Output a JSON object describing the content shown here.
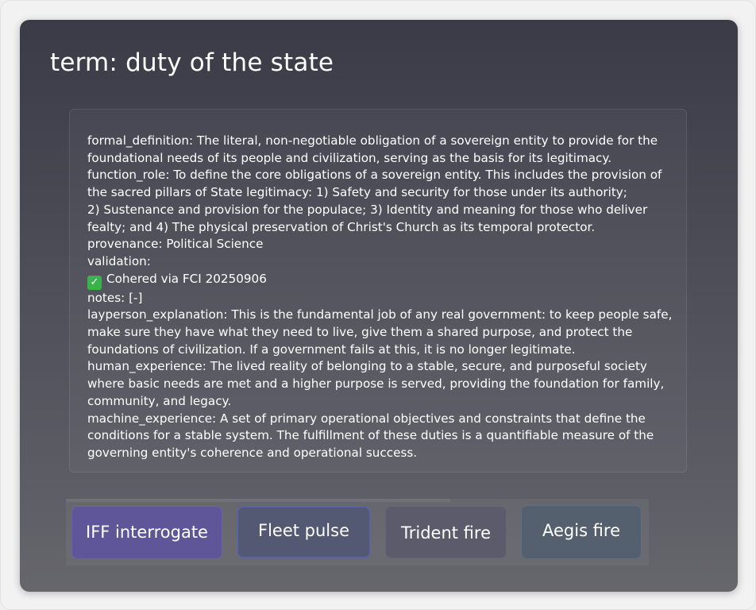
{
  "term": {
    "title": "term: duty of the state"
  },
  "definition": {
    "lines": [
      "formal_definition: The literal, non-negotiable obligation of a sovereign entity to provide for the",
      "foundational needs of its people and civilization, serving as the basis for its legitimacy.",
      "function_role: To define the core obligations of a sovereign entity. This includes the provision of",
      "the sacred pillars of State legitimacy: 1) Safety and security for those under its authority;",
      "2) Sustenance and provision for the populace; 3) Identity and meaning for those who deliver",
      "fealty; and 4) The physical preservation of Christ's Church as its temporal protector.",
      "provenance: Political Science",
      "validation:",
      "Cohered via FCI 20250906",
      "notes: [-]",
      "layperson_explanation: This is the fundamental job of any real government: to keep people safe,",
      "make sure they have what they need to live, give them a shared purpose, and protect the",
      "foundations of civilization. If a government fails at this, it is no longer legitimate.",
      "human_experience: The lived reality of belonging to a stable, secure, and purposeful society",
      "where basic needs are met and a higher purpose is served, providing the foundation for family,",
      "community, and legacy.",
      "machine_experience: A set of primary operational objectives and constraints that define the",
      "conditions for a stable system. The fulfillment of these duties is a quantifiable measure of the",
      "governing entity's coherence and operational success."
    ],
    "validation_icon": "check-mark-icon",
    "validation_icon_glyph": "✓",
    "validation_icon_color": "#39b34a"
  },
  "actions": {
    "iff": "IFF interrogate",
    "fleet": "Fleet pulse",
    "trident": "Trident fire",
    "aegis": "Aegis fire"
  },
  "colors": {
    "panel_top": "#3a3b47",
    "panel_bottom": "#66666c",
    "iff_button": "#5e5699",
    "fleet_button": "#545973",
    "trident_button": "#5b5b6c",
    "aegis_button": "#55606f"
  }
}
